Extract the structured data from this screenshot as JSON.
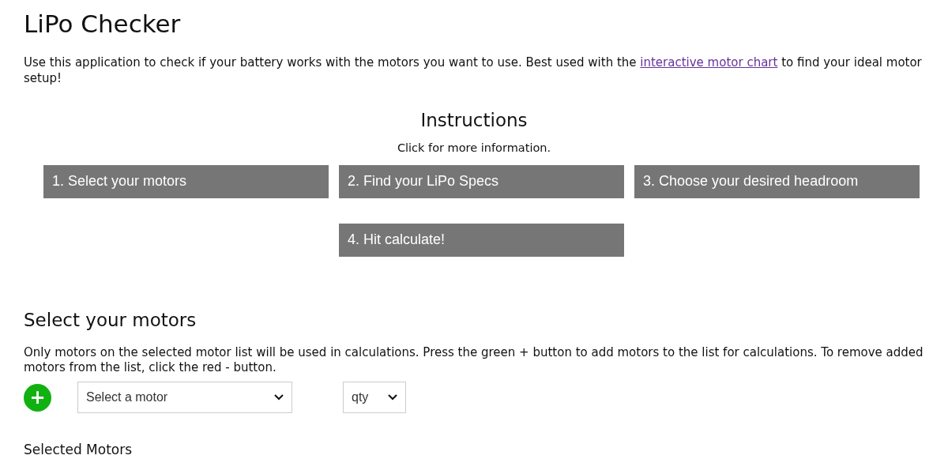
{
  "title": "LiPo Checker",
  "intro": {
    "before": "Use this application to check if your battery works with the motors you want to use. Best used with the ",
    "link": "interactive motor chart",
    "after": " to find your ideal motor setup!"
  },
  "instructions": {
    "heading": "Instructions",
    "hint": "Click for more information.",
    "steps": [
      {
        "label": "1. Select your motors"
      },
      {
        "label": "2. Find your LiPo Specs"
      },
      {
        "label": "3. Choose your desired headroom"
      },
      {
        "label": "4. Hit calculate!"
      }
    ]
  },
  "motors_section": {
    "heading": "Select your motors",
    "description": "Only motors on the selected motor list will be used in calculations. Press the green + button to add motors to the list for calculations. To remove added motors from the list, click the red - button.",
    "add_button": "+",
    "motor_select": {
      "value": "Select a motor"
    },
    "qty_select": {
      "value": "qty"
    },
    "selected_heading": "Selected Motors"
  }
}
